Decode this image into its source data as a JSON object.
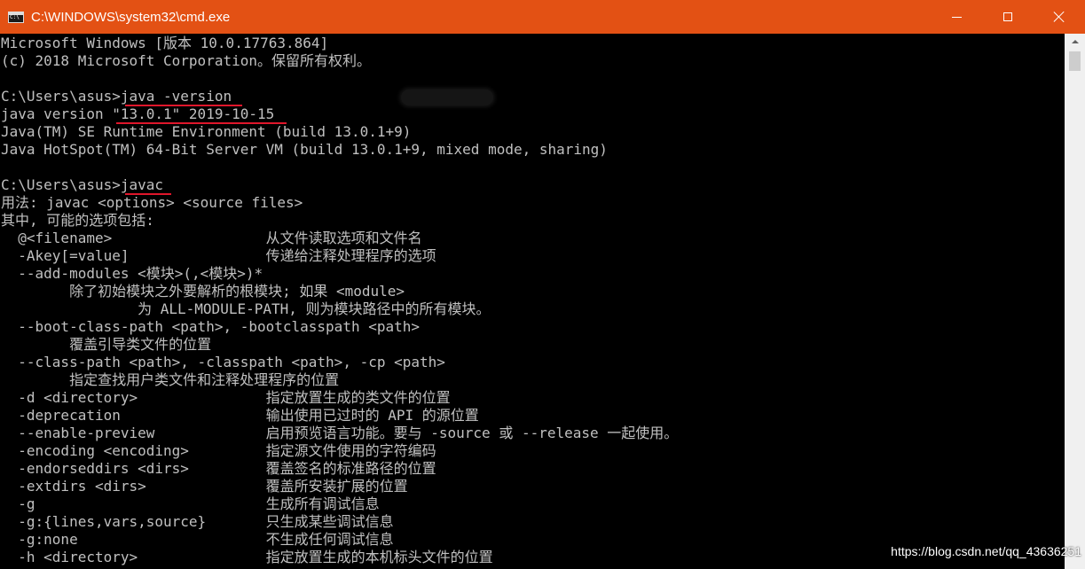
{
  "window": {
    "title": "C:\\WINDOWS\\system32\\cmd.exe",
    "titlebar_color": "#e35114"
  },
  "console": {
    "lines": [
      {
        "text": "Microsoft Windows [版本 10.0.17763.864]"
      },
      {
        "text": "(c) 2018 Microsoft Corporation。保留所有权利。"
      },
      {
        "text": ""
      },
      {
        "text": "C:\\Users\\asus>java -version",
        "underline": {
          "start": "C:\\Users\\asus>",
          "text": "java -version"
        }
      },
      {
        "text": "java version \"13.0.1\" 2019-10-15",
        "underline": {
          "start": "java version ",
          "text": "\"13.0.1\" 2019-10-15"
        }
      },
      {
        "text": "Java(TM) SE Runtime Environment (build 13.0.1+9)"
      },
      {
        "text": "Java HotSpot(TM) 64-Bit Server VM (build 13.0.1+9, mixed mode, sharing)"
      },
      {
        "text": ""
      },
      {
        "text": "C:\\Users\\asus>javac",
        "underline": {
          "start": "C:\\Users\\asus>",
          "text": "javac"
        }
      },
      {
        "text": "用法: javac <options> <source files>"
      },
      {
        "text": "其中, 可能的选项包括:"
      },
      {
        "opt": "  @<filename>",
        "desc": "从文件读取选项和文件名"
      },
      {
        "opt": "  -Akey[=value]",
        "desc": "传递给注释处理程序的选项"
      },
      {
        "text": "  --add-modules <模块>(,<模块>)*"
      },
      {
        "text": "        除了初始模块之外要解析的根模块; 如果 <module>"
      },
      {
        "text": "                为 ALL-MODULE-PATH, 则为模块路径中的所有模块。"
      },
      {
        "text": "  --boot-class-path <path>, -bootclasspath <path>"
      },
      {
        "text": "        覆盖引导类文件的位置"
      },
      {
        "text": "  --class-path <path>, -classpath <path>, -cp <path>"
      },
      {
        "text": "        指定查找用户类文件和注释处理程序的位置"
      },
      {
        "opt": "  -d <directory>",
        "desc": "指定放置生成的类文件的位置"
      },
      {
        "opt": "  -deprecation",
        "desc": "输出使用已过时的 API 的源位置"
      },
      {
        "opt": "  --enable-preview",
        "desc": "启用预览语言功能。要与 -source 或 --release 一起使用。"
      },
      {
        "opt": "  -encoding <encoding>",
        "desc": "指定源文件使用的字符编码"
      },
      {
        "opt": "  -endorseddirs <dirs>",
        "desc": "覆盖签名的标准路径的位置"
      },
      {
        "opt": "  -extdirs <dirs>",
        "desc": "覆盖所安装扩展的位置"
      },
      {
        "opt": "  -g",
        "desc": "生成所有调试信息"
      },
      {
        "opt": "  -g:{lines,vars,source}",
        "desc": "只生成某些调试信息"
      },
      {
        "opt": "  -g:none",
        "desc": "不生成任何调试信息"
      },
      {
        "opt": "  -h <directory>",
        "desc": "指定放置生成的本机标头文件的位置"
      }
    ]
  },
  "watermark": "https://blog.csdn.net/qq_43636251",
  "colors": {
    "console_bg": "#000000",
    "console_text": "#c0c0c0",
    "underline": "#e0162b"
  }
}
